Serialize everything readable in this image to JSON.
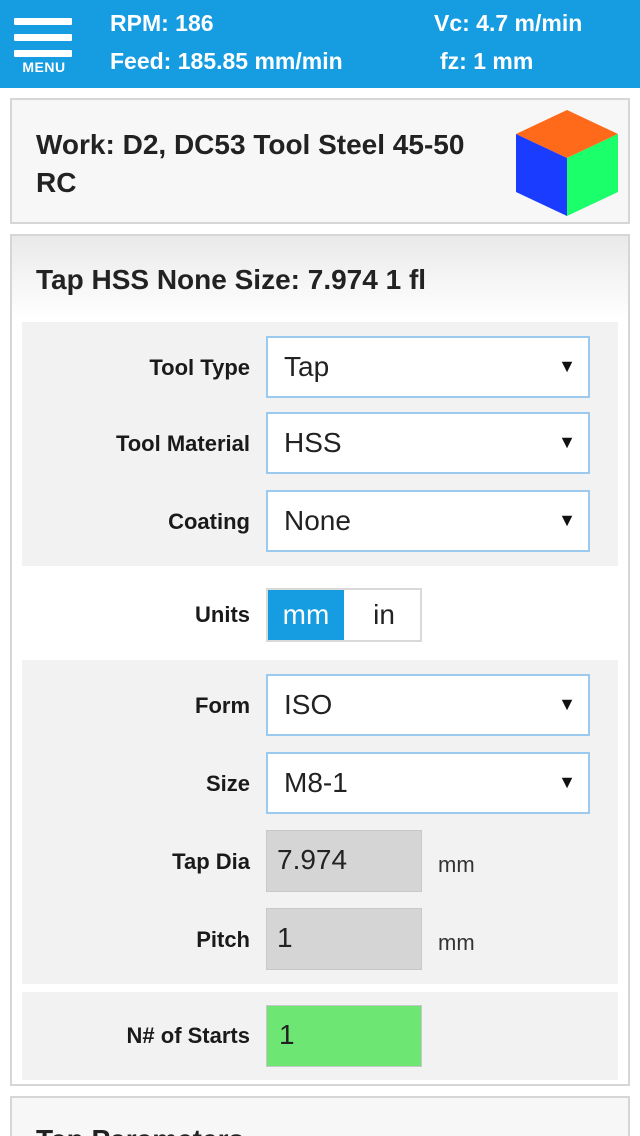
{
  "header": {
    "menu_label": "MENU",
    "rpm": "RPM: 186",
    "feed": "Feed: 185.85 mm/min",
    "vc": "Vc: 4.7 m/min",
    "fz": "fz: 1 mm"
  },
  "work": {
    "title": "Work: D2, DC53 Tool Steel 45-50 RC",
    "icon": "cube-icon"
  },
  "tool": {
    "title": "Tap HSS None Size: 7.974 1 fl",
    "tool_type": {
      "label": "Tool Type",
      "value": "Tap"
    },
    "tool_material": {
      "label": "Tool Material",
      "value": "HSS"
    },
    "coating": {
      "label": "Coating",
      "value": "None"
    },
    "units": {
      "label": "Units",
      "options": [
        "mm",
        "in"
      ],
      "selected": "mm"
    },
    "form": {
      "label": "Form",
      "value": "ISO"
    },
    "size": {
      "label": "Size",
      "value": "M8-1"
    },
    "tap_dia": {
      "label": "Tap Dia",
      "value": "7.974",
      "unit": "mm"
    },
    "pitch": {
      "label": "Pitch",
      "value": "1",
      "unit": "mm"
    },
    "starts": {
      "label": "N# of Starts",
      "value": "1"
    }
  },
  "next_section": {
    "title": "Tap Parameters"
  },
  "colors": {
    "accent": "#169ce0",
    "header_text": "#ffffff",
    "starts_field": "#6ee673",
    "readonly_field": "#d5d5d5",
    "cube_top": "#ff6a1a",
    "cube_left": "#1a3cff",
    "cube_right": "#1aff6a"
  }
}
